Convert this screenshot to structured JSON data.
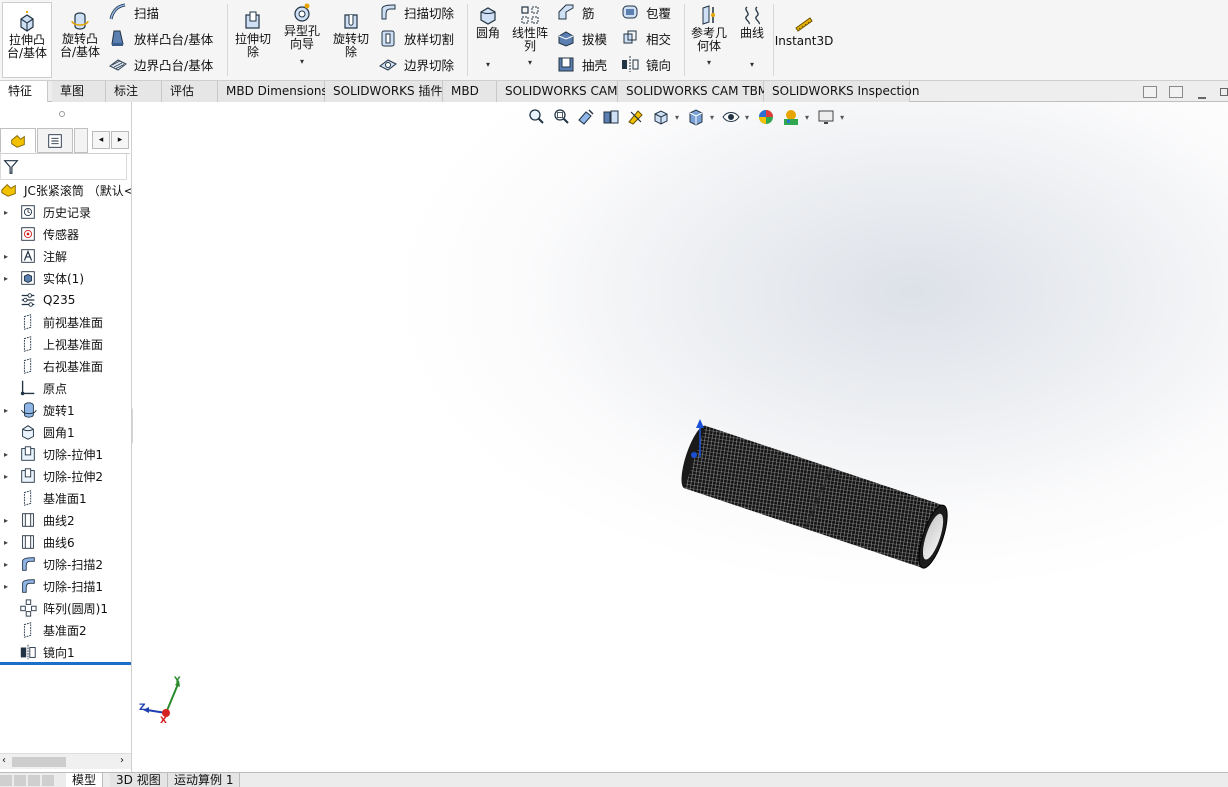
{
  "ribbon": {
    "extrude_boss": "拉伸凸\n台/基体",
    "revolve_boss": "旋转凸\n台/基体",
    "sweep": "扫描",
    "loft_boss": "放样凸台/基体",
    "boundary_boss": "边界凸台/基体",
    "extrude_cut": "拉伸切\n除",
    "hole_wizard": "异型孔\n向导",
    "revolve_cut": "旋转切\n除",
    "sweep_cut": "扫描切除",
    "loft_cut": "放样切割",
    "boundary_cut": "边界切除",
    "fillet": "圆角",
    "linear_pattern": "线性阵\n列",
    "rib": "筋",
    "draft": "拔模",
    "shell": "抽壳",
    "wrap": "包覆",
    "intersect": "相交",
    "mirror": "镜向",
    "reference_geometry": "参考几\n何体",
    "curves": "曲线",
    "instant3d": "Instant3D",
    "dropdown_glyph": "▾"
  },
  "tabs": [
    "特征",
    "草图",
    "标注",
    "评估",
    "MBD Dimensions",
    "SOLIDWORKS 插件",
    "MBD",
    "SOLIDWORKS CAM",
    "SOLIDWORKS CAM TBM",
    "SOLIDWORKS Inspection"
  ],
  "feature_manager": {
    "root": "JC张紧滚筒 （默认<<",
    "items": [
      {
        "label": "历史记录",
        "icon": "history-icon",
        "expandable": true
      },
      {
        "label": "传感器",
        "icon": "sensor-icon",
        "expandable": false
      },
      {
        "label": "注解",
        "icon": "annotation-icon",
        "expandable": true
      },
      {
        "label": "实体(1)",
        "icon": "solid-bodies-icon",
        "expandable": true
      },
      {
        "label": "Q235",
        "icon": "material-icon",
        "expandable": false
      },
      {
        "label": "前视基准面",
        "icon": "plane-icon",
        "expandable": false
      },
      {
        "label": "上视基准面",
        "icon": "plane-icon",
        "expandable": false
      },
      {
        "label": "右视基准面",
        "icon": "plane-icon",
        "expandable": false
      },
      {
        "label": "原点",
        "icon": "origin-icon",
        "expandable": false
      },
      {
        "label": "旋转1",
        "icon": "revolve-icon",
        "expandable": true
      },
      {
        "label": "圆角1",
        "icon": "fillet-icon",
        "expandable": false
      },
      {
        "label": "切除-拉伸1",
        "icon": "cut-extrude-icon",
        "expandable": true
      },
      {
        "label": "切除-拉伸2",
        "icon": "cut-extrude-icon",
        "expandable": true
      },
      {
        "label": "基准面1",
        "icon": "plane-icon",
        "expandable": false
      },
      {
        "label": "曲线2",
        "icon": "curve-icon",
        "expandable": true
      },
      {
        "label": "曲线6",
        "icon": "curve-icon",
        "expandable": true
      },
      {
        "label": "切除-扫描2",
        "icon": "cut-sweep-icon",
        "expandable": true
      },
      {
        "label": "切除-扫描1",
        "icon": "cut-sweep-icon",
        "expandable": true
      },
      {
        "label": "阵列(圆周)1",
        "icon": "circular-pattern-icon",
        "expandable": false
      },
      {
        "label": "基准面2",
        "icon": "plane-icon",
        "expandable": false
      },
      {
        "label": "镜向1",
        "icon": "mirror-icon",
        "expandable": false
      }
    ]
  },
  "triad": {
    "x": "X",
    "y": "Y",
    "z": "Z"
  },
  "bottom_tabs": [
    "模型",
    "3D 视图",
    "运动算例 1"
  ],
  "colors": {
    "accent": "#1a6fc9",
    "axis_x": "#d62020",
    "axis_y": "#2a8a2a",
    "axis_z": "#1f3fb0",
    "selection": "#1a4fd6"
  }
}
